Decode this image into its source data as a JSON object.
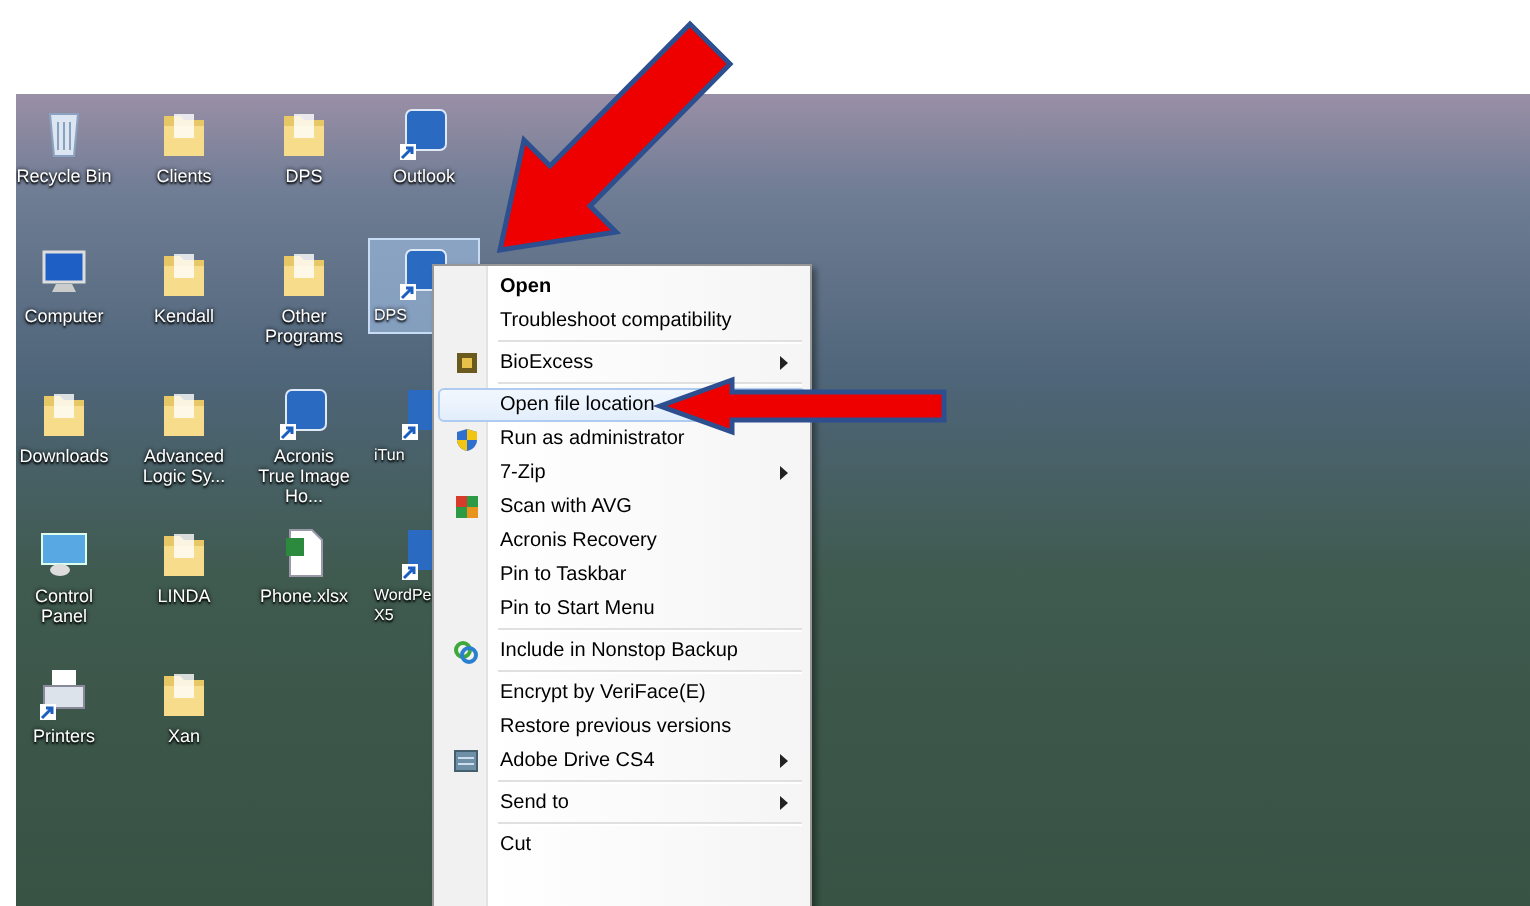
{
  "desktop": {
    "icons": [
      {
        "label": "Recycle Bin",
        "kind": "recycle",
        "selected": false
      },
      {
        "label": "Clients",
        "kind": "folder",
        "selected": false
      },
      {
        "label": "DPS",
        "kind": "folder",
        "selected": false
      },
      {
        "label": "Outlook",
        "kind": "app",
        "selected": false
      },
      {
        "label": "Computer",
        "kind": "computer",
        "selected": false
      },
      {
        "label": "Kendall",
        "kind": "folder",
        "selected": false
      },
      {
        "label": "Other Programs",
        "kind": "folder",
        "selected": false
      },
      {
        "label": "DPS",
        "kind": "app",
        "selected": true
      },
      {
        "label": "Downloads",
        "kind": "folder",
        "selected": false
      },
      {
        "label": "Advanced Logic Sy...",
        "kind": "folder",
        "selected": false
      },
      {
        "label": "Acronis True Image Ho...",
        "kind": "app",
        "selected": false
      },
      {
        "label": "iTun",
        "kind": "app",
        "selected": false
      },
      {
        "label": "Control Panel",
        "kind": "panel",
        "selected": false
      },
      {
        "label": "LINDA",
        "kind": "folder",
        "selected": false
      },
      {
        "label": "Phone.xlsx",
        "kind": "file",
        "selected": false
      },
      {
        "label": "WordPe X5",
        "kind": "app",
        "selected": false
      },
      {
        "label": "Printers",
        "kind": "printer",
        "selected": false
      },
      {
        "label": "Xan",
        "kind": "folder",
        "selected": false
      }
    ]
  },
  "context_menu": {
    "items": [
      {
        "kind": "plain",
        "label": "Open",
        "default": true,
        "submenu": false,
        "highlighted": false
      },
      {
        "kind": "plain",
        "label": "Troubleshoot compatibility",
        "default": false,
        "submenu": false,
        "highlighted": false
      },
      {
        "kind": "separator"
      },
      {
        "kind": "app",
        "label": "BioExcess",
        "default": false,
        "submenu": true,
        "highlighted": false
      },
      {
        "kind": "separator"
      },
      {
        "kind": "plain",
        "label": "Open file location",
        "default": false,
        "submenu": false,
        "highlighted": true
      },
      {
        "kind": "shield",
        "label": "Run as administrator",
        "default": false,
        "submenu": false,
        "highlighted": false
      },
      {
        "kind": "plain",
        "label": "7-Zip",
        "default": false,
        "submenu": true,
        "highlighted": false
      },
      {
        "kind": "avg",
        "label": "Scan with AVG",
        "default": false,
        "submenu": false,
        "highlighted": false
      },
      {
        "kind": "plain",
        "label": "Acronis Recovery",
        "default": false,
        "submenu": false,
        "highlighted": false
      },
      {
        "kind": "plain",
        "label": "Pin to Taskbar",
        "default": false,
        "submenu": false,
        "highlighted": false
      },
      {
        "kind": "plain",
        "label": "Pin to Start Menu",
        "default": false,
        "submenu": false,
        "highlighted": false
      },
      {
        "kind": "separator"
      },
      {
        "kind": "sync",
        "label": "Include in Nonstop Backup",
        "default": false,
        "submenu": false,
        "highlighted": false
      },
      {
        "kind": "separator"
      },
      {
        "kind": "plain",
        "label": "Encrypt by VeriFace(E)",
        "default": false,
        "submenu": false,
        "highlighted": false
      },
      {
        "kind": "plain",
        "label": "Restore previous versions",
        "default": false,
        "submenu": false,
        "highlighted": false
      },
      {
        "kind": "drive",
        "label": "Adobe Drive CS4",
        "default": false,
        "submenu": true,
        "highlighted": false
      },
      {
        "kind": "separator"
      },
      {
        "kind": "plain",
        "label": "Send to",
        "default": false,
        "submenu": true,
        "highlighted": false
      },
      {
        "kind": "separator"
      },
      {
        "kind": "plain",
        "label": "Cut",
        "default": false,
        "submenu": false,
        "highlighted": false
      }
    ]
  }
}
